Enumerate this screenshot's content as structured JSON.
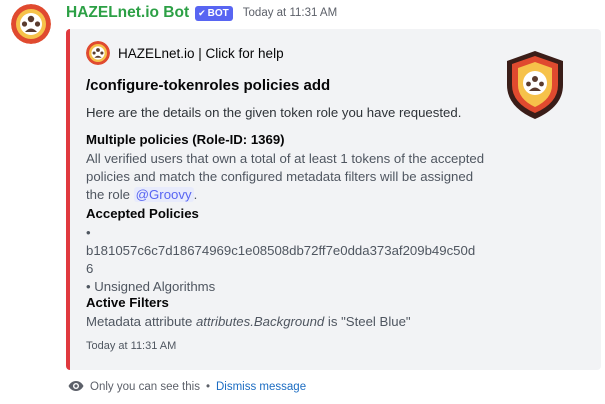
{
  "message": {
    "bot_name": "HAZELnet.io Bot",
    "bot_tag": "BOT",
    "timestamp": "Today at 11:31 AM"
  },
  "embed": {
    "accent_color": "#e0393e",
    "author": "HAZELnet.io | Click for help",
    "title": "/configure-tokenroles policies add",
    "description": "Here are the details on the given token role you have requested.",
    "fields": [
      {
        "name": "Multiple policies (Role-ID: 1369)",
        "lines": [
          "All verified users that own a total of at least 1 tokens of the accepted",
          "policies and match the configured metadata filters will be assigned",
          "the role "
        ],
        "mention": "@Groovy",
        "after_mention": "."
      },
      {
        "name": "Accepted Policies",
        "lines": [
          "•",
          "b181057c6c7d18674969c1e08508db72ff7e0dda373af209b49c50d",
          "6",
          "• Unsigned Algorithms"
        ]
      },
      {
        "name": "Active Filters",
        "prefix": "Metadata attribute ",
        "italic": "attributes.Background",
        "suffix": " is \"Steel Blue\""
      }
    ],
    "footer": "Today at 11:31 AM"
  },
  "ephemeral": {
    "icon": "eye-icon",
    "text": "Only you can see this",
    "separator": "•",
    "dismiss": "Dismiss message"
  },
  "colors": {
    "bot_name": "#2ca045",
    "bot_tag": "#5865f2",
    "link": "#1b6cc2"
  }
}
